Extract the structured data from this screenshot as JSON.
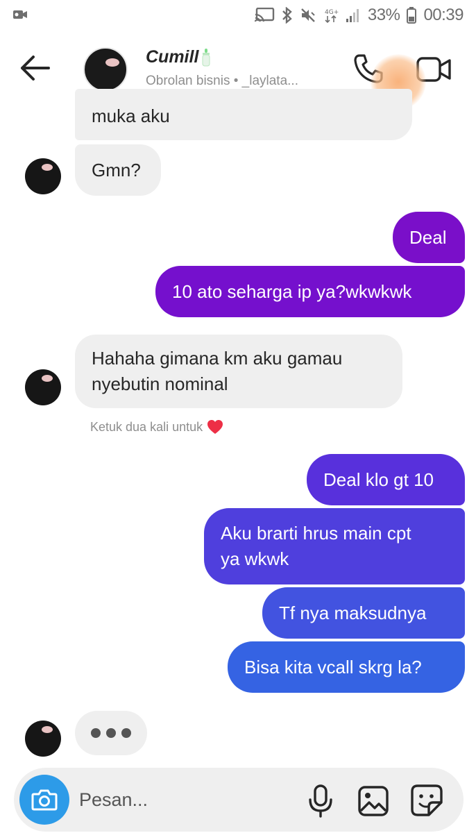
{
  "status_bar": {
    "battery_percent": "33%",
    "time": "00:39",
    "icons": [
      "video-recorder-icon",
      "cast-icon",
      "bluetooth-icon",
      "mute-icon",
      "data-4g-icon",
      "signal-icon",
      "battery-icon"
    ]
  },
  "header": {
    "title": "Cumill",
    "subtitle": "Obrolan bisnis • _laylata...",
    "icons": [
      "back-arrow-icon",
      "baby-bottle-icon",
      "phone-icon",
      "video-camera-icon"
    ]
  },
  "messages": [
    {
      "id": "m1",
      "direction": "incoming",
      "text": "muka aku"
    },
    {
      "id": "m2",
      "direction": "incoming",
      "text": "Gmn?"
    },
    {
      "id": "m3",
      "direction": "outgoing",
      "text": "Deal"
    },
    {
      "id": "m4",
      "direction": "outgoing",
      "text": "10 ato seharga ip ya?wkwkwk"
    },
    {
      "id": "m5",
      "direction": "incoming",
      "lines": [
        "Hahaha gimana km aku gamau",
        "nyebutin nominal"
      ]
    },
    {
      "id": "m6",
      "direction": "outgoing",
      "text": "Deal klo gt 10"
    },
    {
      "id": "m7",
      "direction": "outgoing",
      "lines": [
        "Aku brarti hrus main cpt",
        "ya wkwk"
      ]
    },
    {
      "id": "m8",
      "direction": "outgoing",
      "text": "Tf nya maksudnya"
    },
    {
      "id": "m9",
      "direction": "outgoing",
      "text": "Bisa kita vcall skrg la?"
    }
  ],
  "double_tap_hint": "Ketuk dua kali untuk",
  "typing_indicator": "typing-dots-icon",
  "composer": {
    "placeholder": "Pesan...",
    "icons": [
      "camera-icon",
      "microphone-icon",
      "gallery-icon",
      "sticker-icon"
    ]
  },
  "colors": {
    "outgoing_top": "#7a0fc9",
    "outgoing_mid": "#5a2fdc",
    "outgoing_bottom": "#3563e3",
    "incoming_bg": "#efefef",
    "camera_button": "#2d9be8",
    "heart": "#ed2f46"
  }
}
